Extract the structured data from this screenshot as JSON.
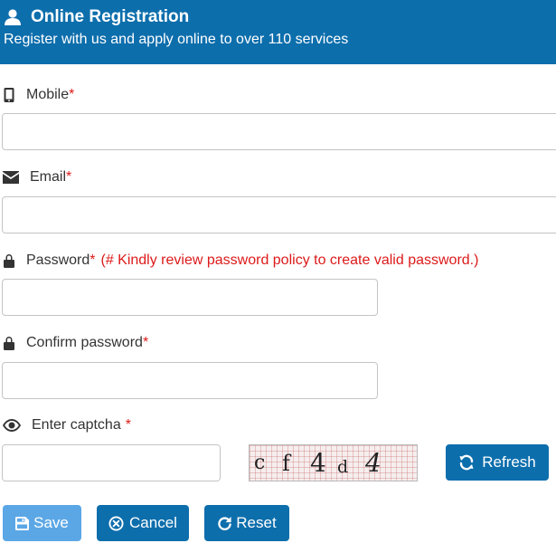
{
  "header": {
    "title": "Online Registration",
    "subtitle": "Register with us and apply online to over 110 services"
  },
  "form": {
    "mobile": {
      "label": "Mobile",
      "required_mark": "*",
      "value": ""
    },
    "email": {
      "label": "Email",
      "required_mark": "*",
      "value": ""
    },
    "password": {
      "label": "Password",
      "required_mark": "*",
      "note": "(# Kindly review password policy to create valid password.)",
      "value": ""
    },
    "confirm_password": {
      "label": "Confirm password",
      "required_mark": "*",
      "value": ""
    },
    "captcha": {
      "label": "Enter captcha",
      "required_mark": "*",
      "value": "",
      "chars": [
        "c",
        "f",
        "4",
        "d",
        "4"
      ]
    }
  },
  "buttons": {
    "refresh": "Refresh",
    "save": "Save",
    "cancel": "Cancel",
    "reset": "Reset"
  },
  "icons": {
    "header": "user-icon",
    "mobile": "mobile-icon",
    "email": "envelope-icon",
    "password": "lock-icon",
    "confirm_password": "lock-icon",
    "captcha": "eye-icon",
    "refresh": "refresh-icon",
    "save": "floppy-disk-icon",
    "cancel": "circle-x-icon",
    "reset": "redo-icon"
  },
  "colors": {
    "primary": "#0d6eac",
    "save_button": "#5ba7e6",
    "required": "#dd1a1a"
  }
}
